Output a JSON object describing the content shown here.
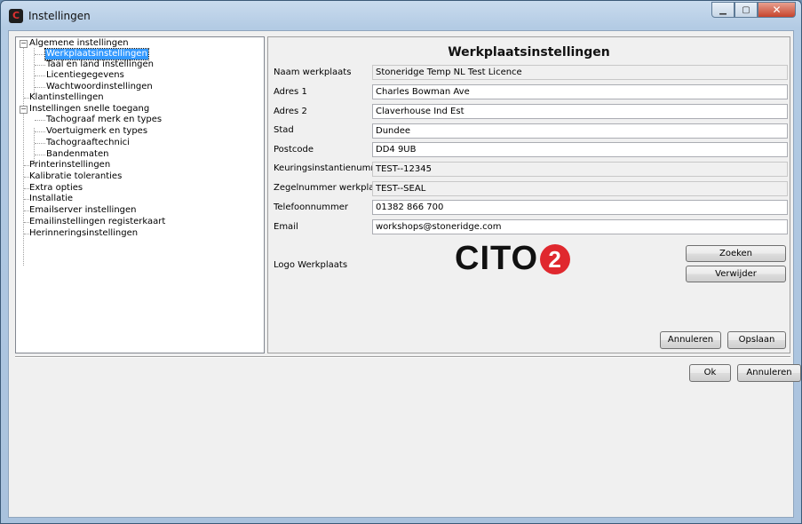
{
  "window": {
    "title": "Instellingen",
    "app_icon": "C",
    "buttons": [
      "minimize-icon",
      "maximize-icon",
      "close-icon"
    ]
  },
  "tree": {
    "items": [
      {
        "label": "Algemene instellingen"
      },
      {
        "label": "Werkplaatsinstellingen",
        "selected": true
      },
      {
        "label": "Taal en land instellingen"
      },
      {
        "label": "Licentiegegevens"
      },
      {
        "label": "Wachtwoordinstellingen"
      },
      {
        "label": "Klantinstellingen"
      },
      {
        "label": "Instellingen snelle toegang"
      },
      {
        "label": "Tachograaf merk en types"
      },
      {
        "label": "Voertuigmerk en types"
      },
      {
        "label": "Tachograaftechnici"
      },
      {
        "label": "Bandenmaten"
      },
      {
        "label": "Printerinstellingen"
      },
      {
        "label": "Kalibratie toleranties"
      },
      {
        "label": "Extra opties"
      },
      {
        "label": "Installatie"
      },
      {
        "label": "Emailserver instellingen"
      },
      {
        "label": "Emailinstellingen registerkaart"
      },
      {
        "label": "Herinneringsinstellingen"
      }
    ]
  },
  "panel": {
    "title": "Werkplaatsinstellingen",
    "fields": {
      "naam": {
        "label": "Naam werkplaats",
        "value": "Stoneridge Temp NL Test Licence"
      },
      "adres1": {
        "label": "Adres 1",
        "value": "Charles Bowman Ave"
      },
      "adres2": {
        "label": "Adres 2",
        "value": "Claverhouse Ind Est"
      },
      "stad": {
        "label": "Stad",
        "value": "Dundee"
      },
      "postcode": {
        "label": "Postcode",
        "value": "DD4 9UB"
      },
      "keuring": {
        "label": "Keuringsinstantienummer",
        "value": "TEST--12345"
      },
      "zegel": {
        "label": "Zegelnummer werkplaats",
        "value": "TEST--SEAL"
      },
      "telefoon": {
        "label": "Telefoonnummer",
        "value": "01382 866 700"
      },
      "email": {
        "label": "Email",
        "value": "workshops@stoneridge.com"
      }
    },
    "logo_label": "Logo Werkplaats",
    "logo_text": "CITO",
    "logo_badge": "2",
    "zoeken": "Zoeken",
    "verwijder": "Verwijder",
    "annuleren": "Annuleren",
    "opslaan": "Opslaan"
  },
  "footer": {
    "ok": "Ok",
    "annuleren": "Annuleren"
  }
}
